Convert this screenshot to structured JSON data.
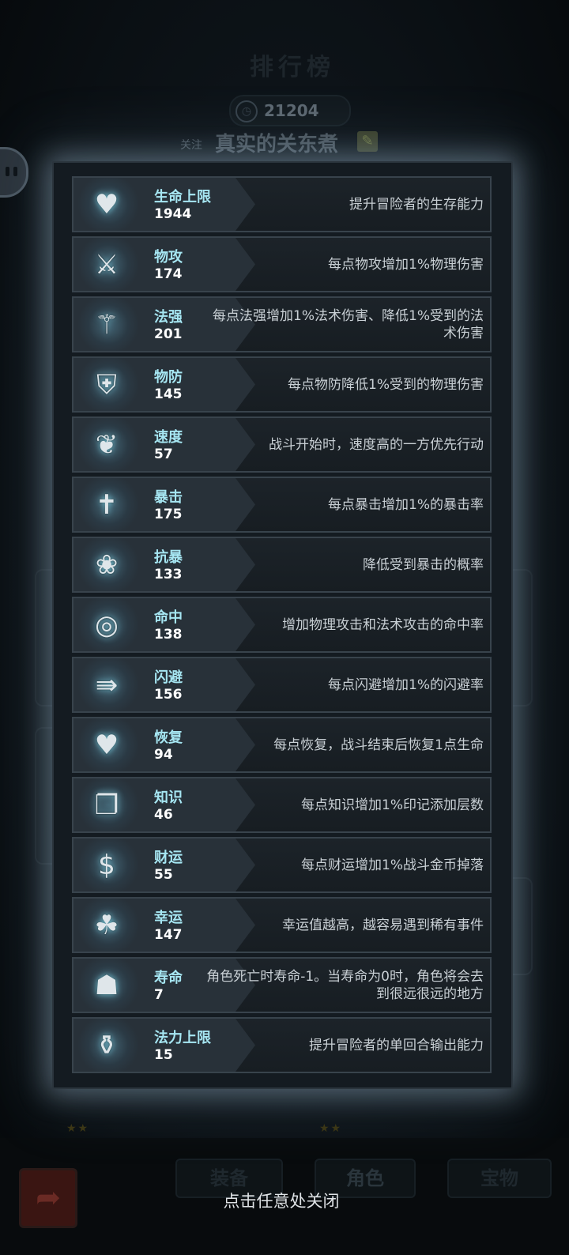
{
  "background": {
    "title": "排行榜",
    "coins": "21204",
    "follow_label": "关注",
    "player_name": "真实的关东煮",
    "tabs": [
      "装备",
      "角色",
      "宝物"
    ]
  },
  "stats": [
    {
      "icon": "heart-up-icon",
      "glyph": "♥",
      "label": "生命上限",
      "value": "1944",
      "desc": "提升冒险者的生存能力"
    },
    {
      "icon": "sword-icon",
      "glyph": "⚔",
      "label": "物攻",
      "value": "174",
      "desc": "每点物攻增加1%物理伤害"
    },
    {
      "icon": "magic-staff-icon",
      "glyph": "⚚",
      "label": "法强",
      "value": "201",
      "desc": "每点法强增加1%法术伤害、降低1%受到的法术伤害"
    },
    {
      "icon": "armor-icon",
      "glyph": "⛨",
      "label": "物防",
      "value": "145",
      "desc": "每点物防降低1%受到的物理伤害"
    },
    {
      "icon": "winged-boot-icon",
      "glyph": "❦",
      "label": "速度",
      "value": "57",
      "desc": "战斗开始时，速度高的一方优先行动"
    },
    {
      "icon": "crit-icon",
      "glyph": "✝",
      "label": "暴击",
      "value": "175",
      "desc": "每点暴击增加1%的暴击率"
    },
    {
      "icon": "crit-resist-icon",
      "glyph": "❀",
      "label": "抗暴",
      "value": "133",
      "desc": "降低受到暴击的概率"
    },
    {
      "icon": "target-icon",
      "glyph": "◎",
      "label": "命中",
      "value": "138",
      "desc": "增加物理攻击和法术攻击的命中率"
    },
    {
      "icon": "dodge-icon",
      "glyph": "⇛",
      "label": "闪避",
      "value": "156",
      "desc": "每点闪避增加1%的闪避率"
    },
    {
      "icon": "heal-heart-icon",
      "glyph": "♥",
      "label": "恢复",
      "value": "94",
      "desc": "每点恢复，战斗结束后恢复1点生命"
    },
    {
      "icon": "book-icon",
      "glyph": "❐",
      "label": "知识",
      "value": "46",
      "desc": "每点知识增加1%印记添加层数"
    },
    {
      "icon": "coin-icon",
      "glyph": "$",
      "label": "财运",
      "value": "55",
      "desc": "每点财运增加1%战斗金币掉落"
    },
    {
      "icon": "clover-icon",
      "glyph": "☘",
      "label": "幸运",
      "value": "147",
      "desc": "幸运值越高，越容易遇到稀有事件"
    },
    {
      "icon": "tombstone-icon",
      "glyph": "☗",
      "label": "寿命",
      "value": "7",
      "desc": "角色死亡时寿命-1。当寿命为0时，角色将会去到很远很远的地方"
    },
    {
      "icon": "mana-flask-icon",
      "glyph": "⚱",
      "label": "法力上限",
      "value": "15",
      "desc": "提升冒险者的单回合输出能力"
    }
  ],
  "close_hint": "点击任意处关闭"
}
